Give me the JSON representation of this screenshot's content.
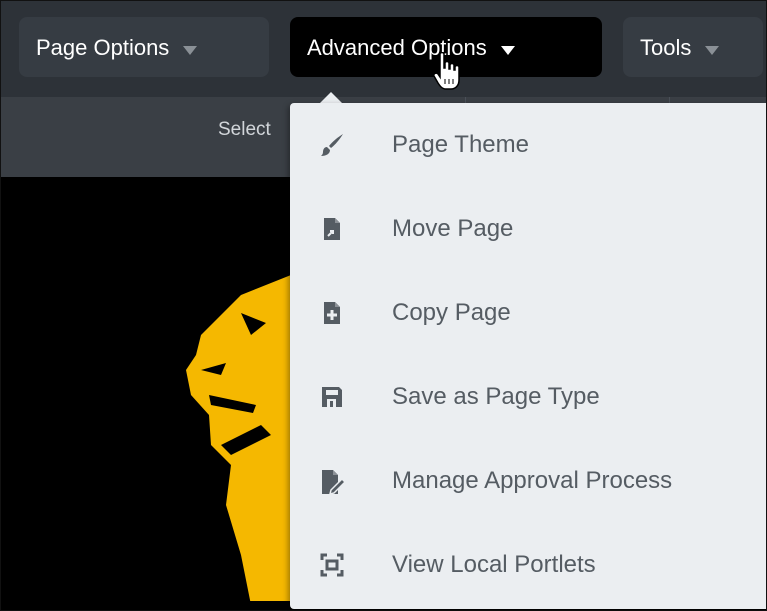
{
  "toolbar": {
    "page_options_label": "Page Options",
    "advanced_options_label": "Advanced Options",
    "tools_label": "Tools"
  },
  "subbar": {
    "select_text": "Select"
  },
  "menu": {
    "items": [
      {
        "label": "Page Theme",
        "icon": "paintbrush-icon"
      },
      {
        "label": "Move Page",
        "icon": "move-page-icon"
      },
      {
        "label": "Copy Page",
        "icon": "copy-page-icon"
      },
      {
        "label": "Save as Page Type",
        "icon": "save-icon"
      },
      {
        "label": "Manage Approval Process",
        "icon": "approval-icon"
      },
      {
        "label": "View Local Portlets",
        "icon": "local-portlets-icon"
      }
    ]
  },
  "colors": {
    "toolbar_bg": "#2d3238",
    "button_bg": "#363c43",
    "active_button_bg": "#000000",
    "menu_bg": "#ebeef1",
    "menu_text": "#555c63",
    "logo_gold": "#f5b800"
  }
}
